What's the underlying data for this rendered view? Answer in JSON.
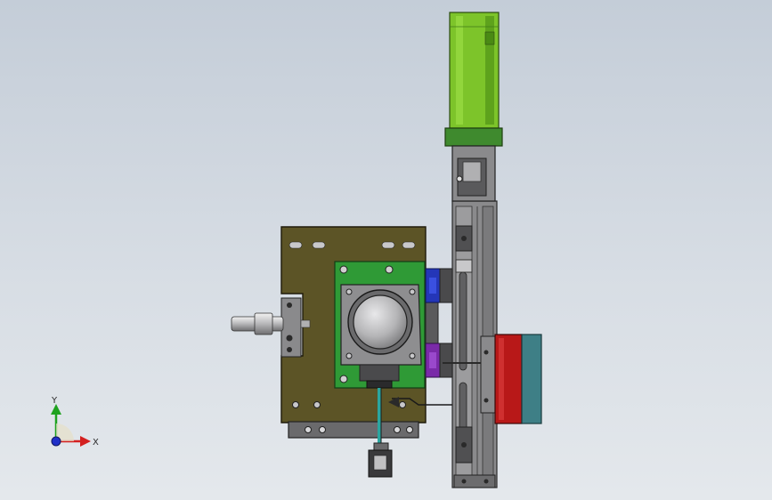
{
  "viewport": {
    "background_top": "#c4cdd8",
    "background_bottom": "#e4e8ec"
  },
  "triad": {
    "x_label": "X",
    "y_label": "Y",
    "x_color": "#d42020",
    "y_color": "#1fa21f",
    "z_color": "#2030c8"
  },
  "colors": {
    "base_plate": "#5c5426",
    "green_pcb": "#2f9a36",
    "motor_body": "#7dc42a",
    "motor_band": "#3f8a2e",
    "red_motor": "#b81818",
    "teal_cap": "#3e7f86",
    "blue_block": "#2436b8",
    "purple_block": "#7a2aa8",
    "frame_gray": "#8a8a8c",
    "dark_gray": "#505052",
    "cable_cyan": "#2aa6a0"
  },
  "parts": {
    "motor": "stepper-motor",
    "sensor": "round-sensor-module",
    "side_motor": "red-side-motor",
    "shaft": "horizontal-shaft",
    "connector": "cable-connector"
  }
}
